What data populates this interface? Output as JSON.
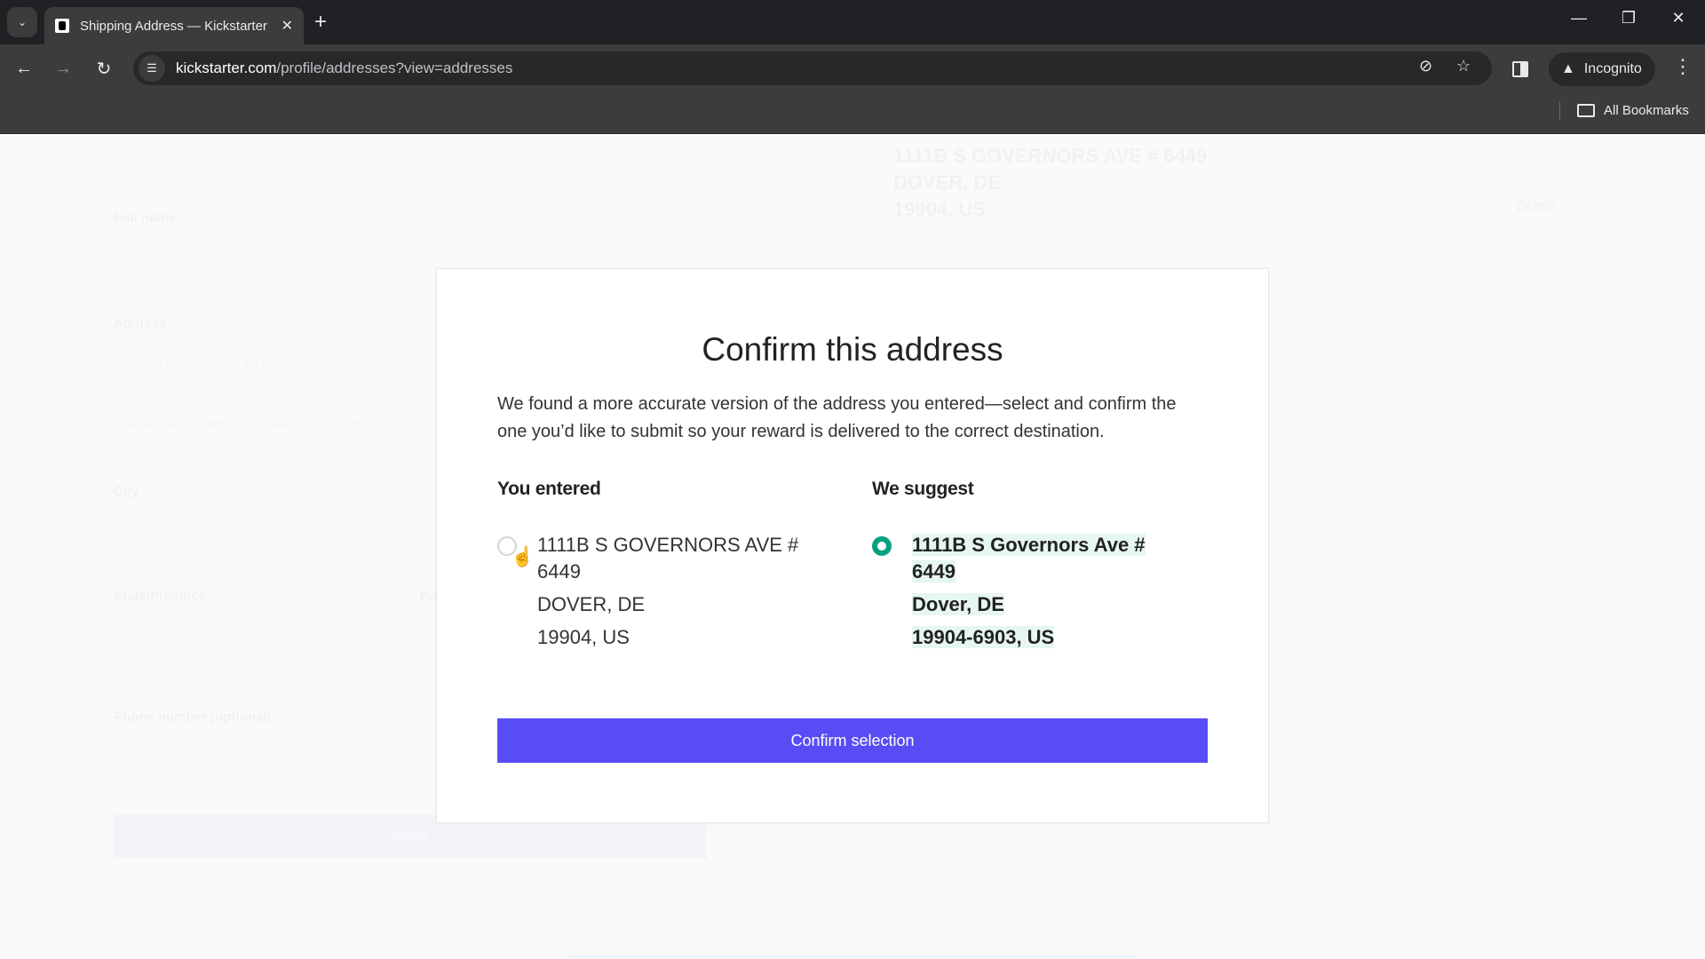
{
  "browser": {
    "tab_title": "Shipping Address — Kickstarter",
    "url_host": "kickstarter.com",
    "url_path": "/profile/addresses?view=addresses",
    "profile_label": "Incognito",
    "bookmarks_label": "All Bookmarks",
    "icons": {
      "tab_search": "chevron-down-icon",
      "close_tab": "close-icon",
      "new_tab": "plus-icon",
      "back": "arrow-left-icon",
      "forward": "arrow-right-icon",
      "reload": "reload-icon",
      "site_info": "tune-icon",
      "eye_off": "eye-off-icon",
      "bookmark": "star-icon",
      "side_panel": "side-panel-icon",
      "incognito": "incognito-icon",
      "menu": "kebab-menu-icon",
      "folder": "folder-icon",
      "minimize": "minimize-icon",
      "restore": "restore-icon",
      "close_window": "close-icon"
    }
  },
  "background_page": {
    "form_labels": {
      "full_name": "Full name",
      "address": "Address",
      "city": "City",
      "state": "State/Province",
      "postal": "Po",
      "phone": "Phone number (optional)"
    },
    "address_placeholder_1": "Street and number, P.O. box, c/o",
    "address_placeholder_2": "Apartment, suite, unit, building, floor, etc.",
    "state_select_value": "Select",
    "save_button": "Save",
    "saved_address": {
      "line1": "1111B S GOVERNORS AVE # 6449",
      "line2": "DOVER, DE",
      "line3": "19904, US"
    },
    "delete_link": "Delete"
  },
  "modal": {
    "title": "Confirm this address",
    "body": "We found a more accurate version of the address you entered—select and confirm the one you’d like to submit so your reward is delivered to the correct destination.",
    "entered": {
      "heading": "You entered",
      "selected": false,
      "street": "1111B S GOVERNORS AVE # 6449",
      "city_state": "DOVER, DE",
      "zip_country": "19904, US"
    },
    "suggested": {
      "heading": "We suggest",
      "selected": true,
      "street": "1111B S Governors Ave # 6449",
      "city_state": "Dover, DE",
      "zip_country": "19904-6903, US"
    },
    "confirm_button": "Confirm selection"
  },
  "colors": {
    "accent_button": "#584cf5",
    "radio_selected": "#05a081",
    "suggest_highlight": "#e6f6f0"
  }
}
